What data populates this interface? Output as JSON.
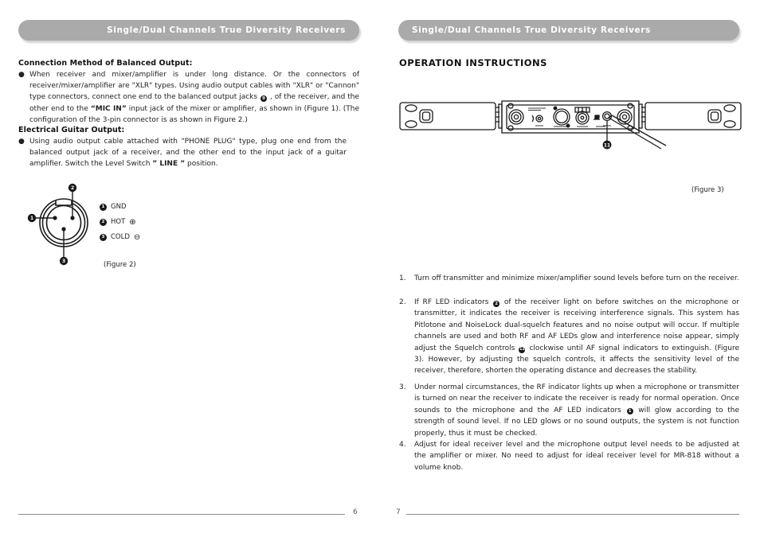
{
  "left_page": {
    "banner_title": "Single/Dual Channels True Diversity Receivers",
    "section1_heading": "Connection Method of Balanced Output:",
    "section1_bullet_marker": "●",
    "section1_text_a": "When receiver and mixer/amplifier is under long distance. Or the connectors of receiver/mixer/amplifier are \"XLR\" types. Using audio output cables with \"XLR\" or \"Cannon\" type connectors, connect one end to the balanced output jacks",
    "section1_inline_marker": "9",
    "section1_text_b": ", of the receiver, and the other end to the",
    "section1_bold": "“MIC IN”",
    "section1_text_c": "input jack of the mixer or amplifier, as shown in (Figure 1). (The configuration of the 3-pin connector is as shown in Figure 2.)",
    "section2_heading": "Electrical Guitar Output:",
    "section2_bullet_marker": "●",
    "section2_text_a": "Using audio output cable attached with \"PHONE PLUG\" type, plug one end from the balanced output jack of a receiver, and the other end to the input jack of a guitar amplifier.  Switch the Level Switch",
    "section2_bold": "” LINE ”",
    "section2_text_b": "position.",
    "figure2": {
      "caption": "(Figure 2)",
      "pin_labels": [
        "1",
        "2",
        "3"
      ],
      "legend": [
        {
          "num": "1",
          "label": "GND",
          "symbol": ""
        },
        {
          "num": "2",
          "label": "HOT",
          "symbol": "⊕"
        },
        {
          "num": "3",
          "label": "COLD",
          "symbol": "⊖"
        }
      ]
    },
    "page_number": "6"
  },
  "right_page": {
    "banner_title": "Single/Dual Channels True Diversity Receivers",
    "heading": "OPERATION INSTRUCTIONS",
    "figure3": {
      "caption": "(Figure 3)",
      "callout_number": "11"
    },
    "instructions": [
      {
        "index": "1.",
        "parts": [
          {
            "t": "text",
            "v": "Turn off transmitter and minimize mixer/amplifier sound levels before turn on the receiver."
          }
        ]
      },
      {
        "index": "2.",
        "parts": [
          {
            "t": "text",
            "v": "If RF LED indicators"
          },
          {
            "t": "cnum",
            "v": "2"
          },
          {
            "t": "text",
            "v": "of the receiver light on before switches on the microphone or transmitter, it indicates the receiver is receiving interference signals.  This system has Pitlotone and NoiseLock dual-squelch features and no noise output will occur.  If multiple channels are used and both RF and AF LEDs glow and interference noise appear, simply adjust the Squelch controls"
          },
          {
            "t": "cnum",
            "v": "11"
          },
          {
            "t": "text",
            "v": "clockwise until AF signal indicators to extinguish. (Figure 3). However, by adjusting the squelch controls, it affects the sensitivity level of the receiver, therefore, shorten the operating distance and decreases the stability."
          }
        ]
      },
      {
        "index": "3.",
        "parts": [
          {
            "t": "text",
            "v": "Under normal circumstances, the RF indicator lights up when a microphone or transmitter is turned on near the receiver to indicate the receiver is ready for normal operation. Once sounds to the microphone and the AF LED indicators"
          },
          {
            "t": "cnum",
            "v": "1"
          },
          {
            "t": "text",
            "v": "will glow according to the strength of sound level. If no LED glows or no sound outputs, the system is not function properly, thus it must be checked."
          }
        ]
      },
      {
        "index": "4.",
        "parts": [
          {
            "t": "text",
            "v": "Adjust for ideal receiver level and the microphone output level needs to be adjusted at the amplifier or mixer. No need to adjust for ideal receiver level for MR-818 without a volume knob."
          }
        ]
      }
    ],
    "page_number": "7"
  },
  "colors": {
    "banner_bg": "#aaaaaa",
    "banner_text": "#ffffff",
    "body_text": "#222222",
    "rule": "#8d8d8d",
    "page_number": "#5a5a5a"
  }
}
